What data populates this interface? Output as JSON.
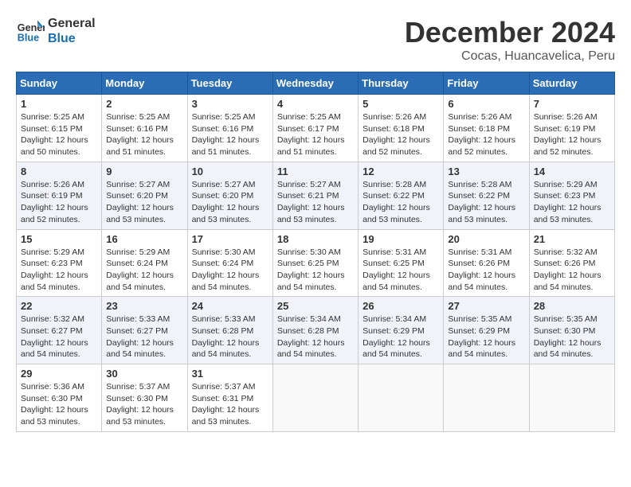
{
  "logo": {
    "line1": "General",
    "line2": "Blue"
  },
  "title": "December 2024",
  "location": "Cocas, Huancavelica, Peru",
  "weekdays": [
    "Sunday",
    "Monday",
    "Tuesday",
    "Wednesday",
    "Thursday",
    "Friday",
    "Saturday"
  ],
  "weeks": [
    [
      {
        "day": "1",
        "sunrise": "5:25 AM",
        "sunset": "6:15 PM",
        "daylight": "12 hours and 50 minutes."
      },
      {
        "day": "2",
        "sunrise": "5:25 AM",
        "sunset": "6:16 PM",
        "daylight": "12 hours and 51 minutes."
      },
      {
        "day": "3",
        "sunrise": "5:25 AM",
        "sunset": "6:16 PM",
        "daylight": "12 hours and 51 minutes."
      },
      {
        "day": "4",
        "sunrise": "5:25 AM",
        "sunset": "6:17 PM",
        "daylight": "12 hours and 51 minutes."
      },
      {
        "day": "5",
        "sunrise": "5:26 AM",
        "sunset": "6:18 PM",
        "daylight": "12 hours and 52 minutes."
      },
      {
        "day": "6",
        "sunrise": "5:26 AM",
        "sunset": "6:18 PM",
        "daylight": "12 hours and 52 minutes."
      },
      {
        "day": "7",
        "sunrise": "5:26 AM",
        "sunset": "6:19 PM",
        "daylight": "12 hours and 52 minutes."
      }
    ],
    [
      {
        "day": "8",
        "sunrise": "5:26 AM",
        "sunset": "6:19 PM",
        "daylight": "12 hours and 52 minutes."
      },
      {
        "day": "9",
        "sunrise": "5:27 AM",
        "sunset": "6:20 PM",
        "daylight": "12 hours and 53 minutes."
      },
      {
        "day": "10",
        "sunrise": "5:27 AM",
        "sunset": "6:20 PM",
        "daylight": "12 hours and 53 minutes."
      },
      {
        "day": "11",
        "sunrise": "5:27 AM",
        "sunset": "6:21 PM",
        "daylight": "12 hours and 53 minutes."
      },
      {
        "day": "12",
        "sunrise": "5:28 AM",
        "sunset": "6:22 PM",
        "daylight": "12 hours and 53 minutes."
      },
      {
        "day": "13",
        "sunrise": "5:28 AM",
        "sunset": "6:22 PM",
        "daylight": "12 hours and 53 minutes."
      },
      {
        "day": "14",
        "sunrise": "5:29 AM",
        "sunset": "6:23 PM",
        "daylight": "12 hours and 53 minutes."
      }
    ],
    [
      {
        "day": "15",
        "sunrise": "5:29 AM",
        "sunset": "6:23 PM",
        "daylight": "12 hours and 54 minutes."
      },
      {
        "day": "16",
        "sunrise": "5:29 AM",
        "sunset": "6:24 PM",
        "daylight": "12 hours and 54 minutes."
      },
      {
        "day": "17",
        "sunrise": "5:30 AM",
        "sunset": "6:24 PM",
        "daylight": "12 hours and 54 minutes."
      },
      {
        "day": "18",
        "sunrise": "5:30 AM",
        "sunset": "6:25 PM",
        "daylight": "12 hours and 54 minutes."
      },
      {
        "day": "19",
        "sunrise": "5:31 AM",
        "sunset": "6:25 PM",
        "daylight": "12 hours and 54 minutes."
      },
      {
        "day": "20",
        "sunrise": "5:31 AM",
        "sunset": "6:26 PM",
        "daylight": "12 hours and 54 minutes."
      },
      {
        "day": "21",
        "sunrise": "5:32 AM",
        "sunset": "6:26 PM",
        "daylight": "12 hours and 54 minutes."
      }
    ],
    [
      {
        "day": "22",
        "sunrise": "5:32 AM",
        "sunset": "6:27 PM",
        "daylight": "12 hours and 54 minutes."
      },
      {
        "day": "23",
        "sunrise": "5:33 AM",
        "sunset": "6:27 PM",
        "daylight": "12 hours and 54 minutes."
      },
      {
        "day": "24",
        "sunrise": "5:33 AM",
        "sunset": "6:28 PM",
        "daylight": "12 hours and 54 minutes."
      },
      {
        "day": "25",
        "sunrise": "5:34 AM",
        "sunset": "6:28 PM",
        "daylight": "12 hours and 54 minutes."
      },
      {
        "day": "26",
        "sunrise": "5:34 AM",
        "sunset": "6:29 PM",
        "daylight": "12 hours and 54 minutes."
      },
      {
        "day": "27",
        "sunrise": "5:35 AM",
        "sunset": "6:29 PM",
        "daylight": "12 hours and 54 minutes."
      },
      {
        "day": "28",
        "sunrise": "5:35 AM",
        "sunset": "6:30 PM",
        "daylight": "12 hours and 54 minutes."
      }
    ],
    [
      {
        "day": "29",
        "sunrise": "5:36 AM",
        "sunset": "6:30 PM",
        "daylight": "12 hours and 53 minutes."
      },
      {
        "day": "30",
        "sunrise": "5:37 AM",
        "sunset": "6:30 PM",
        "daylight": "12 hours and 53 minutes."
      },
      {
        "day": "31",
        "sunrise": "5:37 AM",
        "sunset": "6:31 PM",
        "daylight": "12 hours and 53 minutes."
      },
      null,
      null,
      null,
      null
    ]
  ],
  "labels": {
    "sunrise": "Sunrise:",
    "sunset": "Sunset:",
    "daylight": "Daylight:"
  }
}
